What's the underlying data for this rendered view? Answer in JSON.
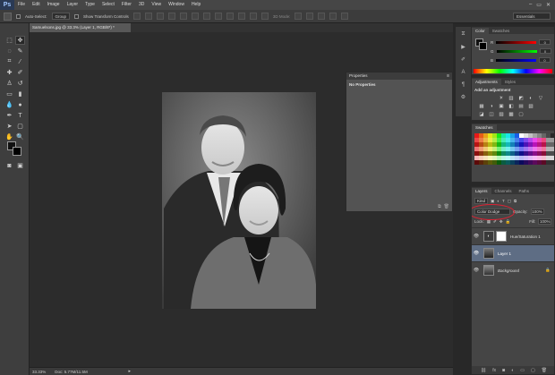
{
  "menubar": {
    "logo": "Ps",
    "items": [
      "File",
      "Edit",
      "Image",
      "Layer",
      "Type",
      "Select",
      "Filter",
      "3D",
      "View",
      "Window",
      "Help"
    ],
    "window_controls": [
      "–",
      "▭",
      "✕"
    ]
  },
  "options_bar": {
    "auto_select_label": "Auto-Select:",
    "auto_select_value": "Group",
    "show_transform_label": "Show Transform Controls",
    "mode_3d_label": "3D Mode:",
    "workspace": "Essentials"
  },
  "document": {
    "tab_title": "Samuelsons.jpg @ 33.3% (Layer 1, RGB/8*) *",
    "zoom": "33.33%",
    "doc_size": "Doc: 5.77M/11.5M"
  },
  "properties": {
    "title": "Properties",
    "subtitle": "No Properties"
  },
  "color_panel": {
    "tabs": [
      "Color",
      "Swatches"
    ],
    "rows": [
      {
        "label": "R",
        "value": "0"
      },
      {
        "label": "G",
        "value": "0"
      },
      {
        "label": "B",
        "value": "0"
      }
    ]
  },
  "adjustments_panel": {
    "tabs": [
      "Adjustments",
      "Styles"
    ],
    "heading": "Add an adjustment",
    "row1_icons": [
      "☀",
      "▥",
      "◩",
      "◐",
      "▽"
    ],
    "row2_icons": [
      "▦",
      "◑",
      "▣",
      "◧",
      "▤",
      "▧"
    ],
    "row3_icons": [
      "◪",
      "◫",
      "▨",
      "▩",
      "▢"
    ]
  },
  "swatches_panel": {
    "tab": "Swatches"
  },
  "layers_panel": {
    "tabs": [
      "Layers",
      "Channels",
      "Paths"
    ],
    "kind_label": "Kind",
    "blend_mode": "Color Dodge",
    "opacity_label": "Opacity:",
    "opacity": "100%",
    "lock_label": "Lock:",
    "fill_label": "Fill:",
    "fill": "100%",
    "layers": [
      {
        "name": "Hue/Saturation 1",
        "selected": false
      },
      {
        "name": "Layer 1",
        "selected": true
      },
      {
        "name": "Background",
        "selected": false
      }
    ]
  },
  "colors": {
    "accent_selection": "#5e6d84",
    "highlight_ring": "#dd2233"
  }
}
